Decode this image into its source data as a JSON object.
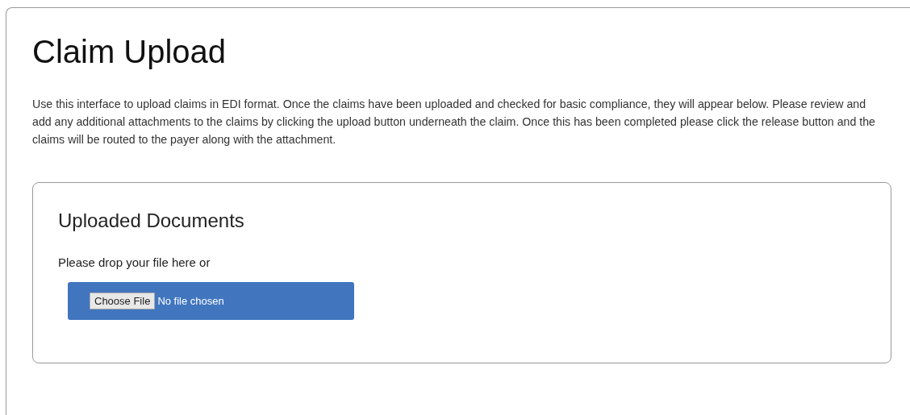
{
  "title": "Claim Upload",
  "intro": "Use this interface to upload claims in EDI format. Once the claims have been uploaded and checked for basic compliance, they will appear below. Please review and add any additional attachments to the claims by clicking the upload button underneath the claim. Once this has been completed please click the release button and the claims will be routed to the payer along with the attachment.",
  "panel": {
    "heading": "Uploaded Documents",
    "drop_text": "Please drop your file here or",
    "file_input": {
      "button": "Choose File",
      "status": "No file chosen"
    }
  }
}
